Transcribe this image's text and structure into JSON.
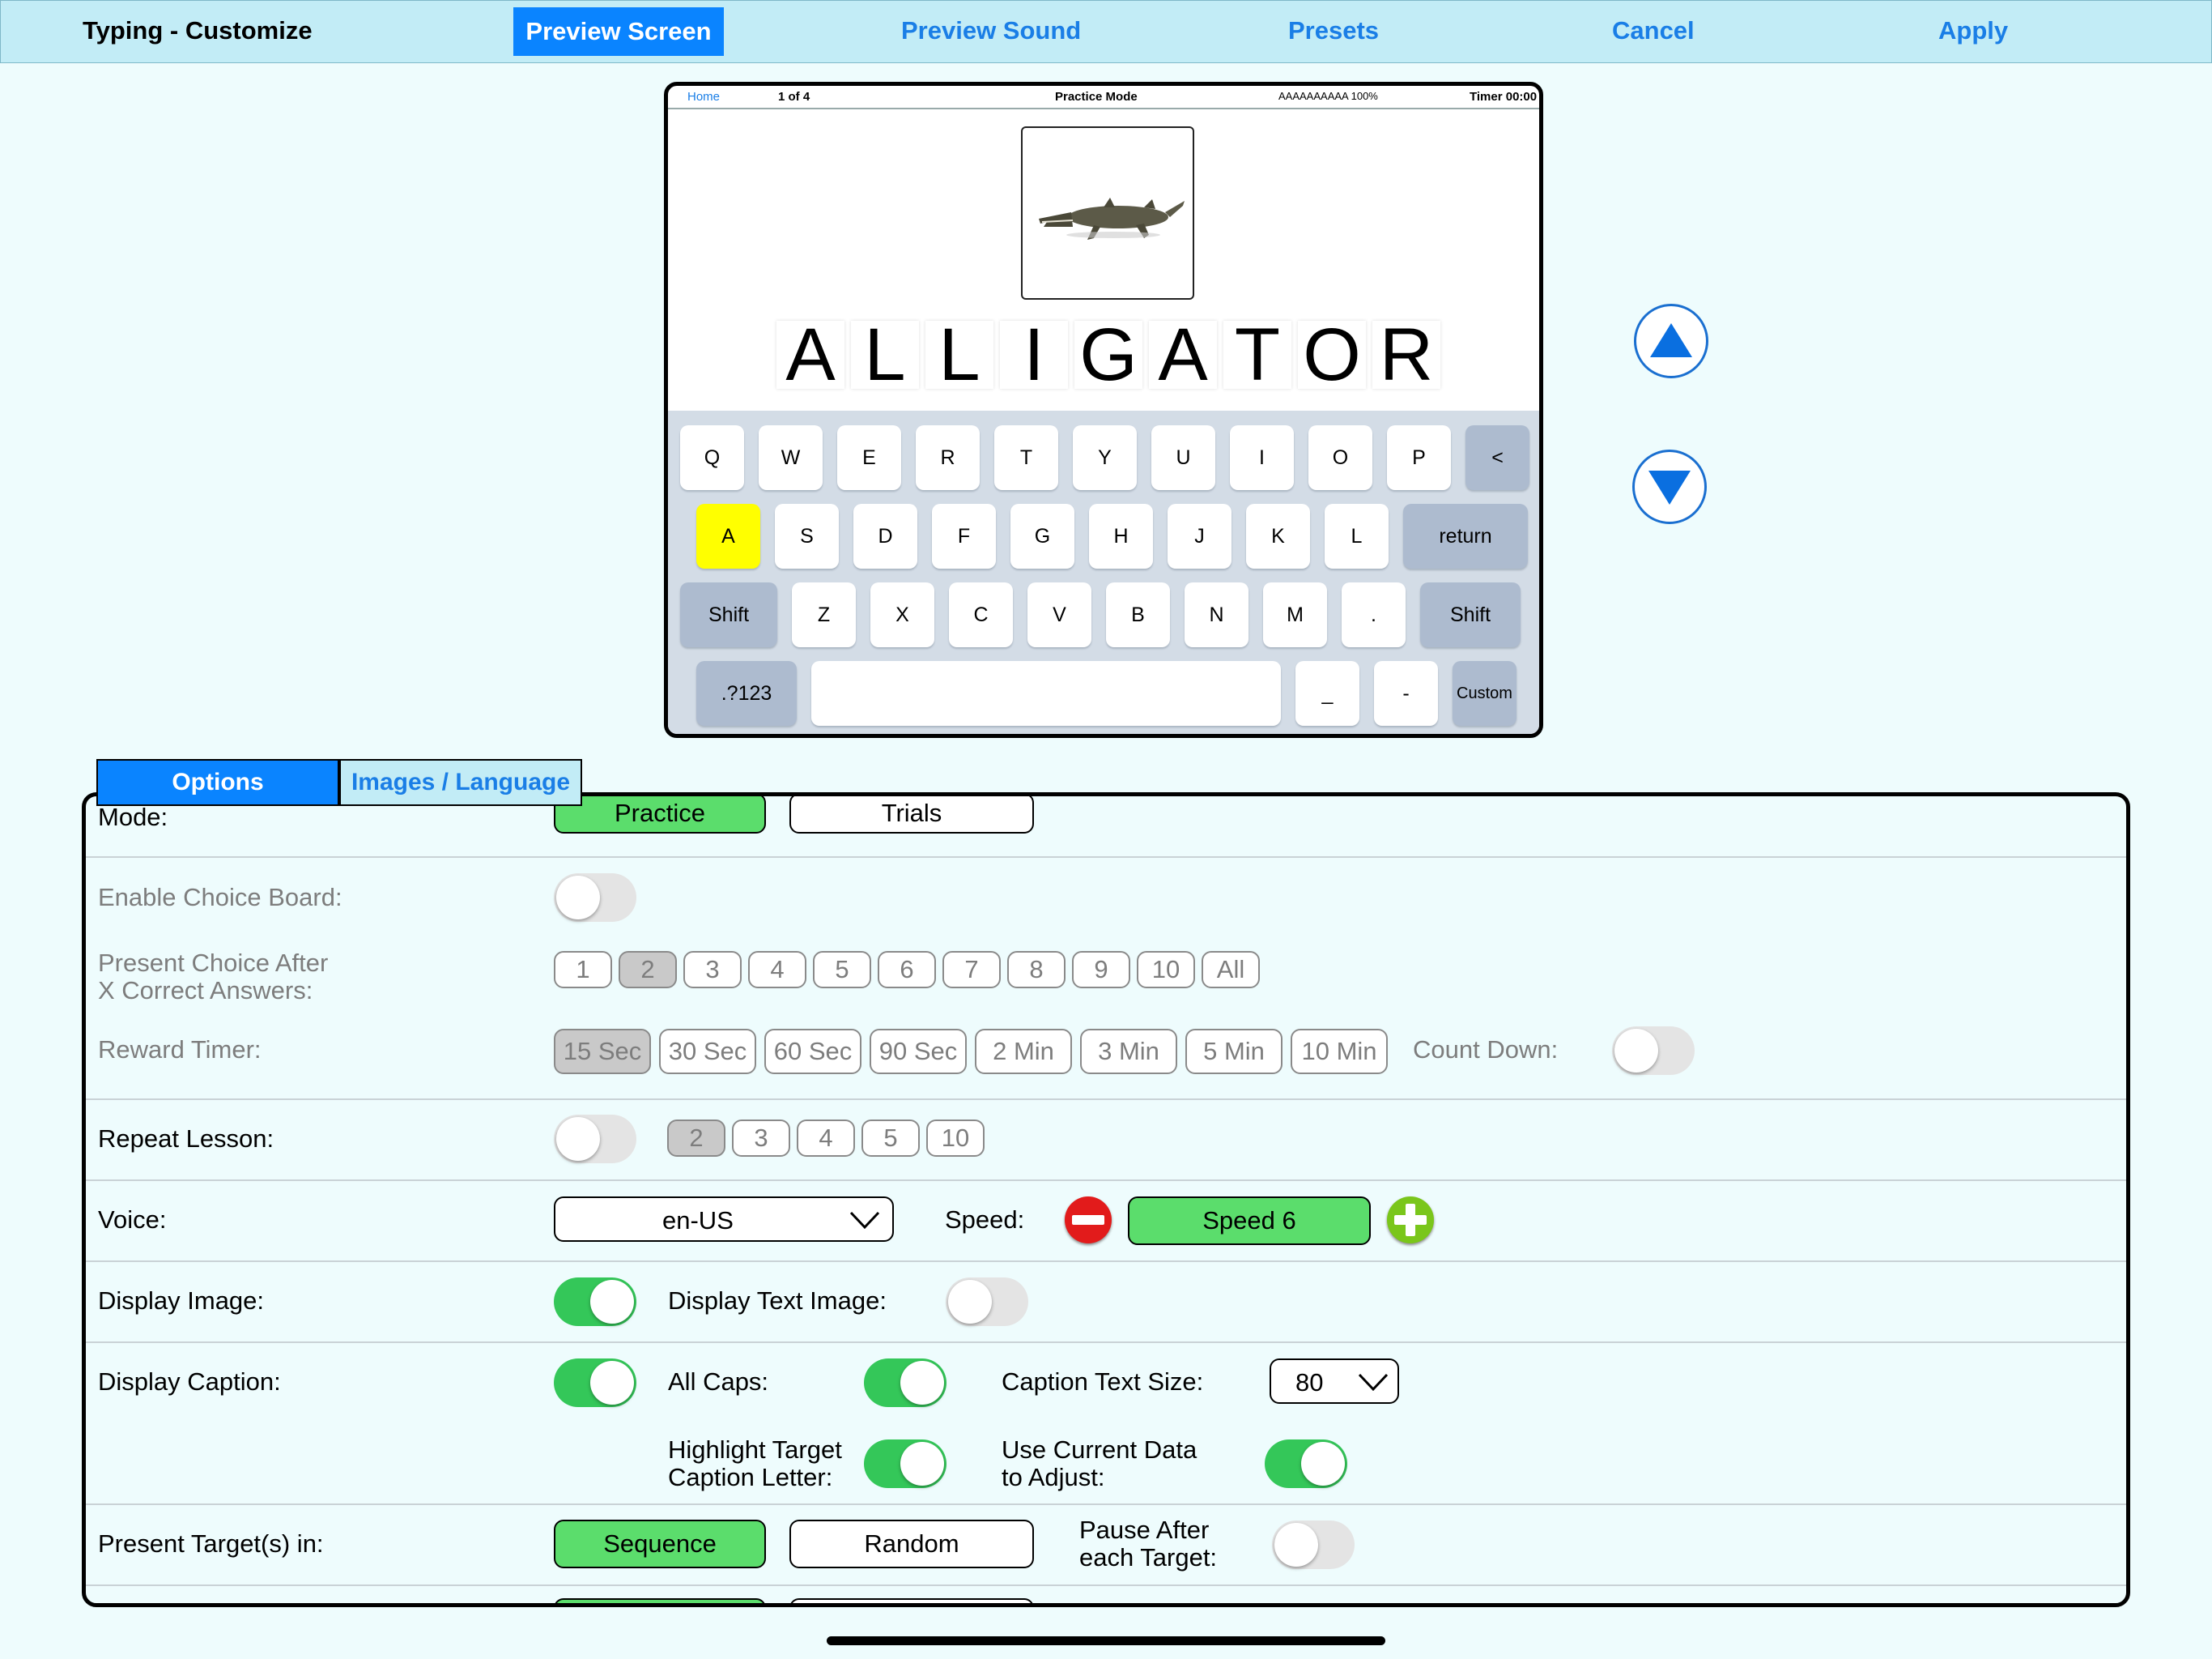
{
  "header": {
    "title": "Typing - Customize",
    "preview_screen": "Preview Screen",
    "preview_sound": "Preview Sound",
    "presets": "Presets",
    "cancel": "Cancel",
    "apply": "Apply"
  },
  "preview": {
    "status": {
      "home": "Home",
      "page": "1 of 4",
      "mode": "Practice Mode",
      "progress": "AAAAAAAAAA 100%",
      "timer": "Timer 00:00"
    },
    "image_icon": "alligator-image",
    "word_letters": [
      "A",
      "L",
      "L",
      "I",
      "G",
      "A",
      "T",
      "O",
      "R"
    ],
    "keyboard": {
      "row1": [
        "Q",
        "W",
        "E",
        "R",
        "T",
        "Y",
        "U",
        "I",
        "O",
        "P",
        "<"
      ],
      "row2": [
        "A",
        "S",
        "D",
        "F",
        "G",
        "H",
        "J",
        "K",
        "L",
        "return"
      ],
      "row3": [
        "Shift",
        "Z",
        "X",
        "C",
        "V",
        "B",
        "N",
        "M",
        ".",
        "Shift"
      ],
      "row4": [
        ".?123",
        "",
        "_",
        "-",
        "Custom"
      ],
      "highlighted_key": "A"
    }
  },
  "tabs": {
    "options": "Options",
    "images_language": "Images / Language",
    "active": "Options"
  },
  "settings": {
    "mode": {
      "label": "Mode:",
      "practice": "Practice",
      "trials": "Trials",
      "selected": "Practice"
    },
    "choice_board": {
      "label": "Enable Choice Board:",
      "on": false
    },
    "present_choice": {
      "label_line1": "Present Choice After",
      "label_line2": "X Correct Answers:",
      "options": [
        "1",
        "2",
        "3",
        "4",
        "5",
        "6",
        "7",
        "8",
        "9",
        "10",
        "All"
      ],
      "selected": "2"
    },
    "reward_timer": {
      "label": "Reward Timer:",
      "options": [
        "15 Sec",
        "30 Sec",
        "60 Sec",
        "90 Sec",
        "2 Min",
        "3 Min",
        "5 Min",
        "10 Min"
      ],
      "selected": "15 Sec",
      "count_down_label": "Count Down:",
      "count_down_on": false
    },
    "repeat_lesson": {
      "label": "Repeat Lesson:",
      "on": false,
      "options": [
        "2",
        "3",
        "4",
        "5",
        "10"
      ],
      "selected": "2"
    },
    "voice": {
      "label": "Voice:",
      "value": "en-US",
      "speed_label": "Speed:",
      "speed_value": "Speed 6"
    },
    "display_image": {
      "label": "Display Image:",
      "on": true,
      "text_image_label": "Display Text Image:",
      "text_image_on": false
    },
    "display_caption": {
      "label": "Display Caption:",
      "on": true,
      "all_caps_label": "All Caps:",
      "all_caps_on": true,
      "caption_size_label": "Caption Text Size:",
      "caption_size_value": "80",
      "highlight_label_line1": "Highlight Target",
      "highlight_label_line2": "Caption Letter:",
      "highlight_on": true,
      "use_data_label_line1": "Use Current Data",
      "use_data_label_line2": "to Adjust:",
      "use_data_on": true
    },
    "present_targets": {
      "label": "Present Target(s) in:",
      "sequence": "Sequence",
      "random": "Random",
      "selected": "Sequence",
      "pause_label_line1": "Pause After",
      "pause_label_line2": "each Target:",
      "pause_on": false
    }
  },
  "colors": {
    "accent": "#0a84ff",
    "topbar": "#c2ecf6",
    "background": "#eefcfd",
    "selected_green": "#5bdd6c",
    "toggle_on": "#34c759"
  }
}
